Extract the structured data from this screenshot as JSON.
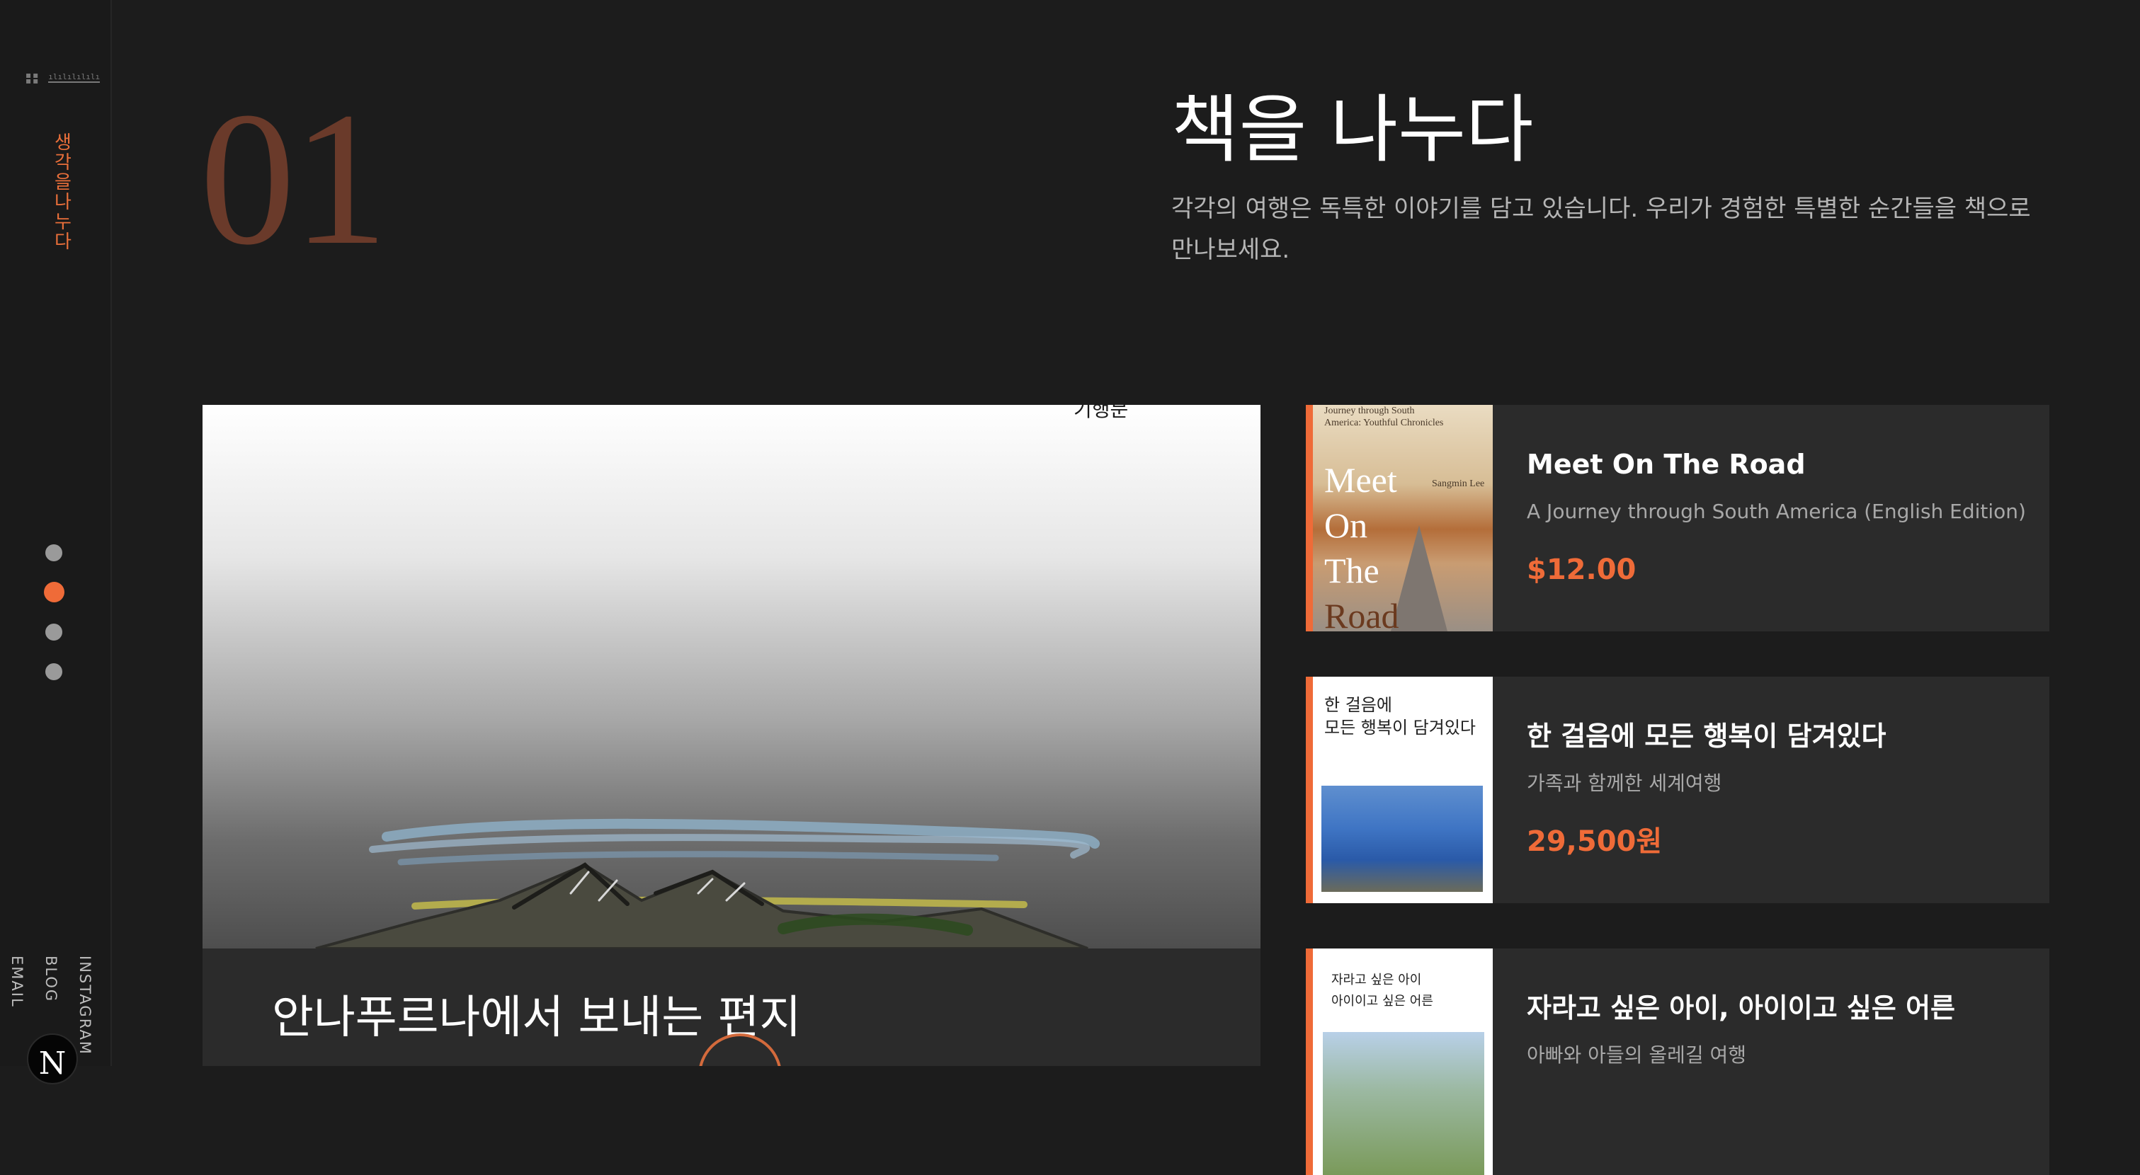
{
  "sidebar": {
    "logo_dots": "▪▪\n▪▪",
    "logo_text": "ılılılılılı",
    "vertical_title": "생각을나누다",
    "nav_dots": [
      {
        "active": false
      },
      {
        "active": true
      },
      {
        "active": false
      },
      {
        "active": false
      }
    ],
    "social_links": [
      "EMAIL",
      "BLOG",
      "INSTAGRAM"
    ],
    "avatar_letter": "N"
  },
  "section": {
    "number": "01",
    "title": "책을 나누다",
    "description": "각각의 여행은 독특한 이야기를 담고 있습니다. 우리가 경험한 특별한 순간들을 책으로 만나보세요."
  },
  "feature": {
    "image_top_text": "빛과 이야기 · 기행문",
    "title": "안나푸르나에서 보내는 편지"
  },
  "books": [
    {
      "title": "Meet On The Road",
      "subtitle": "A Journey through South America (English Edition)",
      "price": "$12.00",
      "cover_small": "Journey through South America: Youthful Chronicles",
      "cover_author": "Sangmin Lee",
      "cover_big": [
        "Meet",
        "On",
        "The",
        "Road"
      ]
    },
    {
      "title": "한 걸음에 모든 행복이 담겨있다",
      "subtitle": "가족과 함께한 세계여행",
      "price": "29,500원",
      "cover_heading_1": "한 걸음에",
      "cover_heading_2": "모든 행복이 담겨있다"
    },
    {
      "title": "자라고 싶은 아이, 아이이고 싶은 어른",
      "subtitle": "아빠와 아들의 올레길 여행",
      "price": "",
      "cover_heading_1": "자라고 싶은 아이",
      "cover_heading_2": "아이이고 싶은 어른"
    }
  ],
  "colors": {
    "accent": "#ef6b38",
    "background": "#1c1c1c",
    "card": "#2b2b2b",
    "number": "#6a3a2a"
  }
}
